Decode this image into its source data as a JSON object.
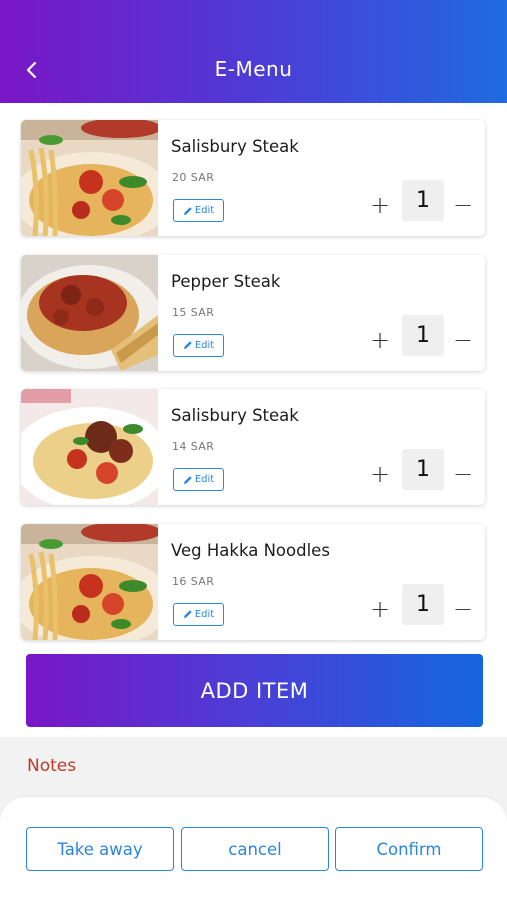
{
  "header": {
    "title": "E-Menu",
    "back_icon": "chevron-left-icon"
  },
  "items": [
    {
      "name": "Salisbury Steak",
      "price": "20 SAR",
      "edit_label": "Edit",
      "quantity": "1",
      "plus": "+",
      "minus": "−"
    },
    {
      "name": "Pepper Steak",
      "price": "15 SAR",
      "edit_label": "Edit",
      "quantity": "1",
      "plus": "+",
      "minus": "−"
    },
    {
      "name": "Salisbury Steak",
      "price": "14 SAR",
      "edit_label": "Edit",
      "quantity": "1",
      "plus": "+",
      "minus": "−"
    },
    {
      "name": "Veg Hakka Noodles",
      "price": "16 SAR",
      "edit_label": "Edit",
      "quantity": "1",
      "plus": "+",
      "minus": "−"
    }
  ],
  "actions": {
    "add_item": "ADD ITEM"
  },
  "notes": {
    "label": "Notes"
  },
  "footer": {
    "take_away": "Take away",
    "cancel": "cancel",
    "confirm": "Confirm"
  },
  "colors": {
    "gradient_start": "#7a16c6",
    "gradient_end": "#1466de",
    "accent_blue": "#2a86dd",
    "notes_red": "#c0392b"
  }
}
